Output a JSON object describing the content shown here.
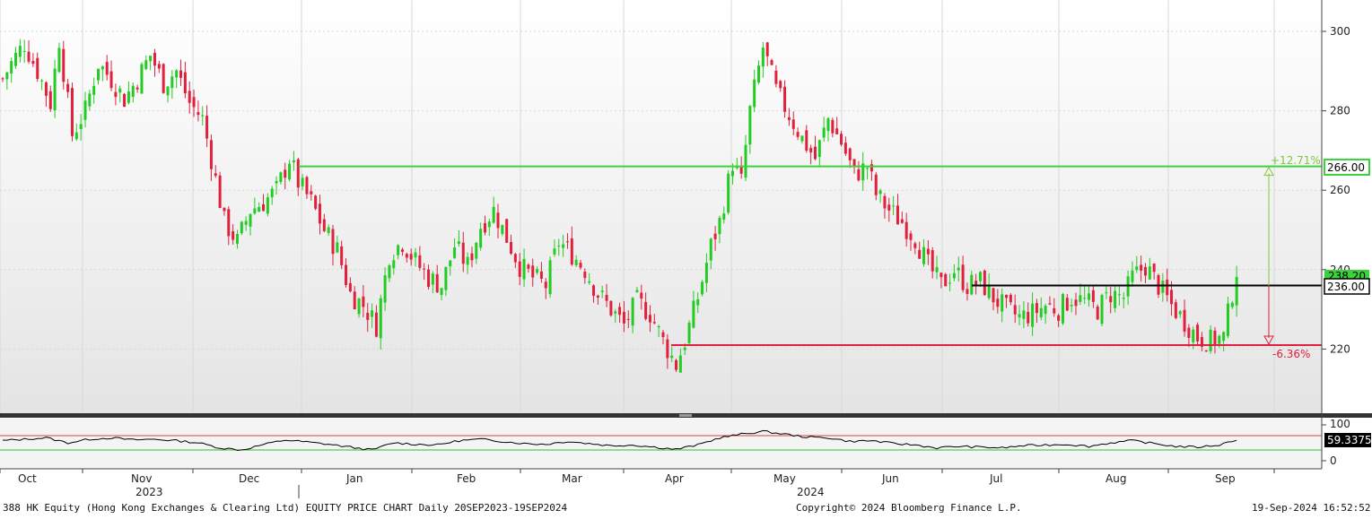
{
  "colors": {
    "up": "#22cc22",
    "down": "#e0203c",
    "resistance": "#3ad43a",
    "support": "#e0203c",
    "pivot": "#000000",
    "rsi_line": "#000000",
    "rsi_upper": "#e04040",
    "rsi_lower": "#30c030"
  },
  "axis": {
    "price_ticks": [
      "300",
      "280",
      "260",
      "240",
      "220"
    ],
    "rsi_ticks": [
      "100",
      "0"
    ],
    "months": [
      "Oct",
      "Nov",
      "Dec",
      "Jan",
      "Feb",
      "Mar",
      "Apr",
      "May",
      "Jun",
      "Jul",
      "Aug",
      "Sep"
    ],
    "years": [
      "2023",
      "2024"
    ]
  },
  "price_tags": {
    "resistance": "266.00",
    "pivot": "236.00",
    "last_hidden": "238.20",
    "rsi": "59.3375"
  },
  "annotations": {
    "upside": "+12.71%",
    "downside": "-6.36%"
  },
  "footer": {
    "left": "388 HK Equity (Hong Kong Exchanges & Clearing Ltd) EQUITY PRICE CHART  Daily 20SEP2023-19SEP2024",
    "center": "Copyright© 2024 Bloomberg Finance L.P.",
    "right": "19-Sep-2024 16:52:52"
  },
  "chart_data": {
    "type": "candlestick",
    "ticker": "388 HK Equity",
    "period": "Daily 20SEP2023-19SEP2024",
    "ylim": [
      203,
      306
    ],
    "rsi_ylim": [
      0,
      100
    ],
    "rsi_bands": [
      70,
      30
    ],
    "rsi_last": 59.3375,
    "levels": {
      "resistance": 266.0,
      "pivot": 236.0,
      "support": 221.0
    },
    "changes": {
      "to_resistance_pct": 12.71,
      "to_support_pct": -6.36
    },
    "close_path": [
      [
        0,
        288
      ],
      [
        2,
        292
      ],
      [
        5,
        297
      ],
      [
        8,
        290
      ],
      [
        11,
        282
      ],
      [
        13,
        298
      ],
      [
        16,
        274
      ],
      [
        19,
        280
      ],
      [
        22,
        292
      ],
      [
        25,
        288
      ],
      [
        28,
        283
      ],
      [
        31,
        288
      ],
      [
        34,
        294
      ],
      [
        37,
        287
      ],
      [
        40,
        290
      ],
      [
        43,
        282
      ],
      [
        46,
        278
      ],
      [
        48,
        268
      ],
      [
        51,
        252
      ],
      [
        54,
        247
      ],
      [
        57,
        255
      ],
      [
        60,
        257
      ],
      [
        63,
        260
      ],
      [
        66,
        268
      ],
      [
        68,
        262
      ],
      [
        71,
        257
      ],
      [
        74,
        250
      ],
      [
        77,
        245
      ],
      [
        80,
        234
      ],
      [
        83,
        231
      ],
      [
        86,
        226
      ],
      [
        89,
        244
      ],
      [
        92,
        247
      ],
      [
        95,
        242
      ],
      [
        98,
        238
      ],
      [
        101,
        236
      ],
      [
        104,
        246
      ],
      [
        107,
        241
      ],
      [
        110,
        251
      ],
      [
        113,
        255
      ],
      [
        116,
        248
      ],
      [
        119,
        241
      ],
      [
        122,
        238
      ],
      [
        125,
        236
      ],
      [
        128,
        247
      ],
      [
        131,
        244
      ],
      [
        134,
        240
      ],
      [
        137,
        234
      ],
      [
        140,
        230
      ],
      [
        143,
        226
      ],
      [
        146,
        232
      ],
      [
        149,
        229
      ],
      [
        152,
        222
      ],
      [
        155,
        216
      ],
      [
        157,
        222
      ],
      [
        160,
        233
      ],
      [
        163,
        246
      ],
      [
        165,
        252
      ],
      [
        168,
        267
      ],
      [
        170,
        262
      ],
      [
        172,
        280
      ],
      [
        175,
        296
      ],
      [
        178,
        285
      ],
      [
        181,
        279
      ],
      [
        184,
        273
      ],
      [
        187,
        268
      ],
      [
        190,
        278
      ],
      [
        193,
        272
      ],
      [
        196,
        264
      ],
      [
        199,
        266
      ],
      [
        201,
        259
      ],
      [
        204,
        255
      ],
      [
        207,
        252
      ],
      [
        210,
        248
      ],
      [
        213,
        241
      ],
      [
        216,
        236
      ],
      [
        219,
        240
      ],
      [
        222,
        236
      ],
      [
        225,
        237
      ],
      [
        228,
        233
      ],
      [
        231,
        230
      ],
      [
        234,
        228
      ],
      [
        237,
        229
      ],
      [
        240,
        231
      ],
      [
        243,
        230
      ],
      [
        246,
        233
      ],
      [
        249,
        232
      ],
      [
        252,
        230
      ],
      [
        255,
        234
      ],
      [
        258,
        233
      ],
      [
        260,
        238
      ],
      [
        263,
        241
      ],
      [
        266,
        236
      ],
      [
        269,
        231
      ],
      [
        272,
        227
      ],
      [
        275,
        223
      ],
      [
        278,
        222
      ],
      [
        281,
        223
      ],
      [
        284,
        240
      ]
    ],
    "rsi_path": [
      [
        0,
        56
      ],
      [
        5,
        60
      ],
      [
        10,
        64
      ],
      [
        15,
        50
      ],
      [
        20,
        60
      ],
      [
        25,
        64
      ],
      [
        30,
        58
      ],
      [
        35,
        60
      ],
      [
        40,
        56
      ],
      [
        45,
        50
      ],
      [
        50,
        36
      ],
      [
        55,
        30
      ],
      [
        60,
        45
      ],
      [
        65,
        58
      ],
      [
        70,
        52
      ],
      [
        75,
        46
      ],
      [
        80,
        38
      ],
      [
        85,
        30
      ],
      [
        90,
        50
      ],
      [
        95,
        46
      ],
      [
        100,
        44
      ],
      [
        105,
        56
      ],
      [
        110,
        60
      ],
      [
        115,
        54
      ],
      [
        120,
        48
      ],
      [
        125,
        46
      ],
      [
        130,
        54
      ],
      [
        135,
        48
      ],
      [
        140,
        42
      ],
      [
        145,
        44
      ],
      [
        150,
        38
      ],
      [
        155,
        32
      ],
      [
        160,
        44
      ],
      [
        165,
        64
      ],
      [
        170,
        74
      ],
      [
        175,
        82
      ],
      [
        180,
        74
      ],
      [
        185,
        66
      ],
      [
        190,
        64
      ],
      [
        195,
        54
      ],
      [
        200,
        56
      ],
      [
        205,
        48
      ],
      [
        210,
        44
      ],
      [
        215,
        36
      ],
      [
        220,
        40
      ],
      [
        225,
        38
      ],
      [
        230,
        36
      ],
      [
        235,
        42
      ],
      [
        240,
        44
      ],
      [
        245,
        46
      ],
      [
        250,
        40
      ],
      [
        255,
        50
      ],
      [
        260,
        56
      ],
      [
        265,
        48
      ],
      [
        270,
        40
      ],
      [
        275,
        38
      ],
      [
        280,
        44
      ],
      [
        284,
        59.34
      ]
    ]
  }
}
